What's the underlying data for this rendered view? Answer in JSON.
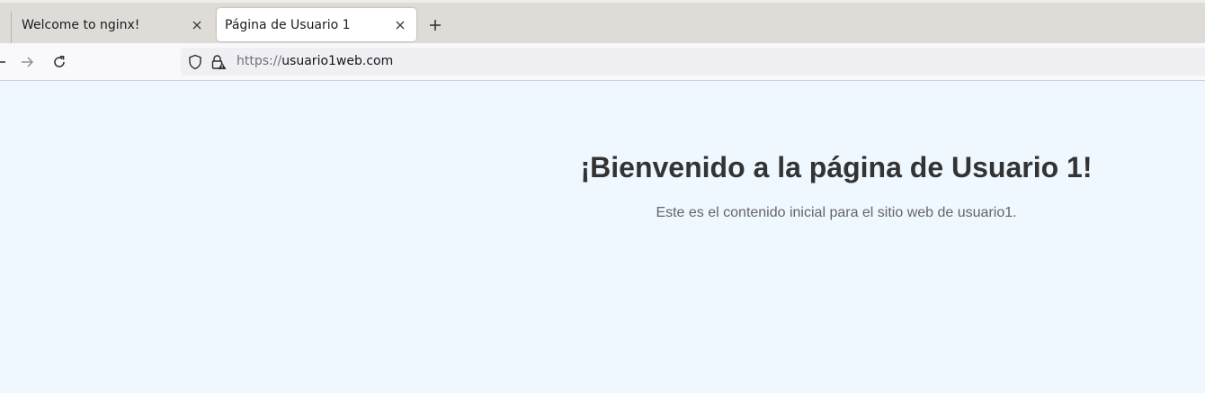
{
  "browser": {
    "tabs": [
      {
        "title": "Welcome to nginx!",
        "active": false
      },
      {
        "title": "Página de Usuario 1",
        "active": true
      }
    ],
    "new_tab_icon": "plus-icon",
    "close_icon": "close-icon",
    "nav": {
      "back_icon": "arrow-left-icon",
      "forward_icon": "arrow-right-icon",
      "reload_icon": "reload-icon"
    },
    "url": {
      "scheme": "https://",
      "host": "usuario1web.com",
      "shield_icon": "shield-icon",
      "lock_icon": "lock-warning-icon"
    }
  },
  "page": {
    "heading": "¡Bienvenido a la página de Usuario 1!",
    "paragraph": "Este es el contenido inicial para el sitio web de usuario1.",
    "background_color": "#eff7ff"
  }
}
